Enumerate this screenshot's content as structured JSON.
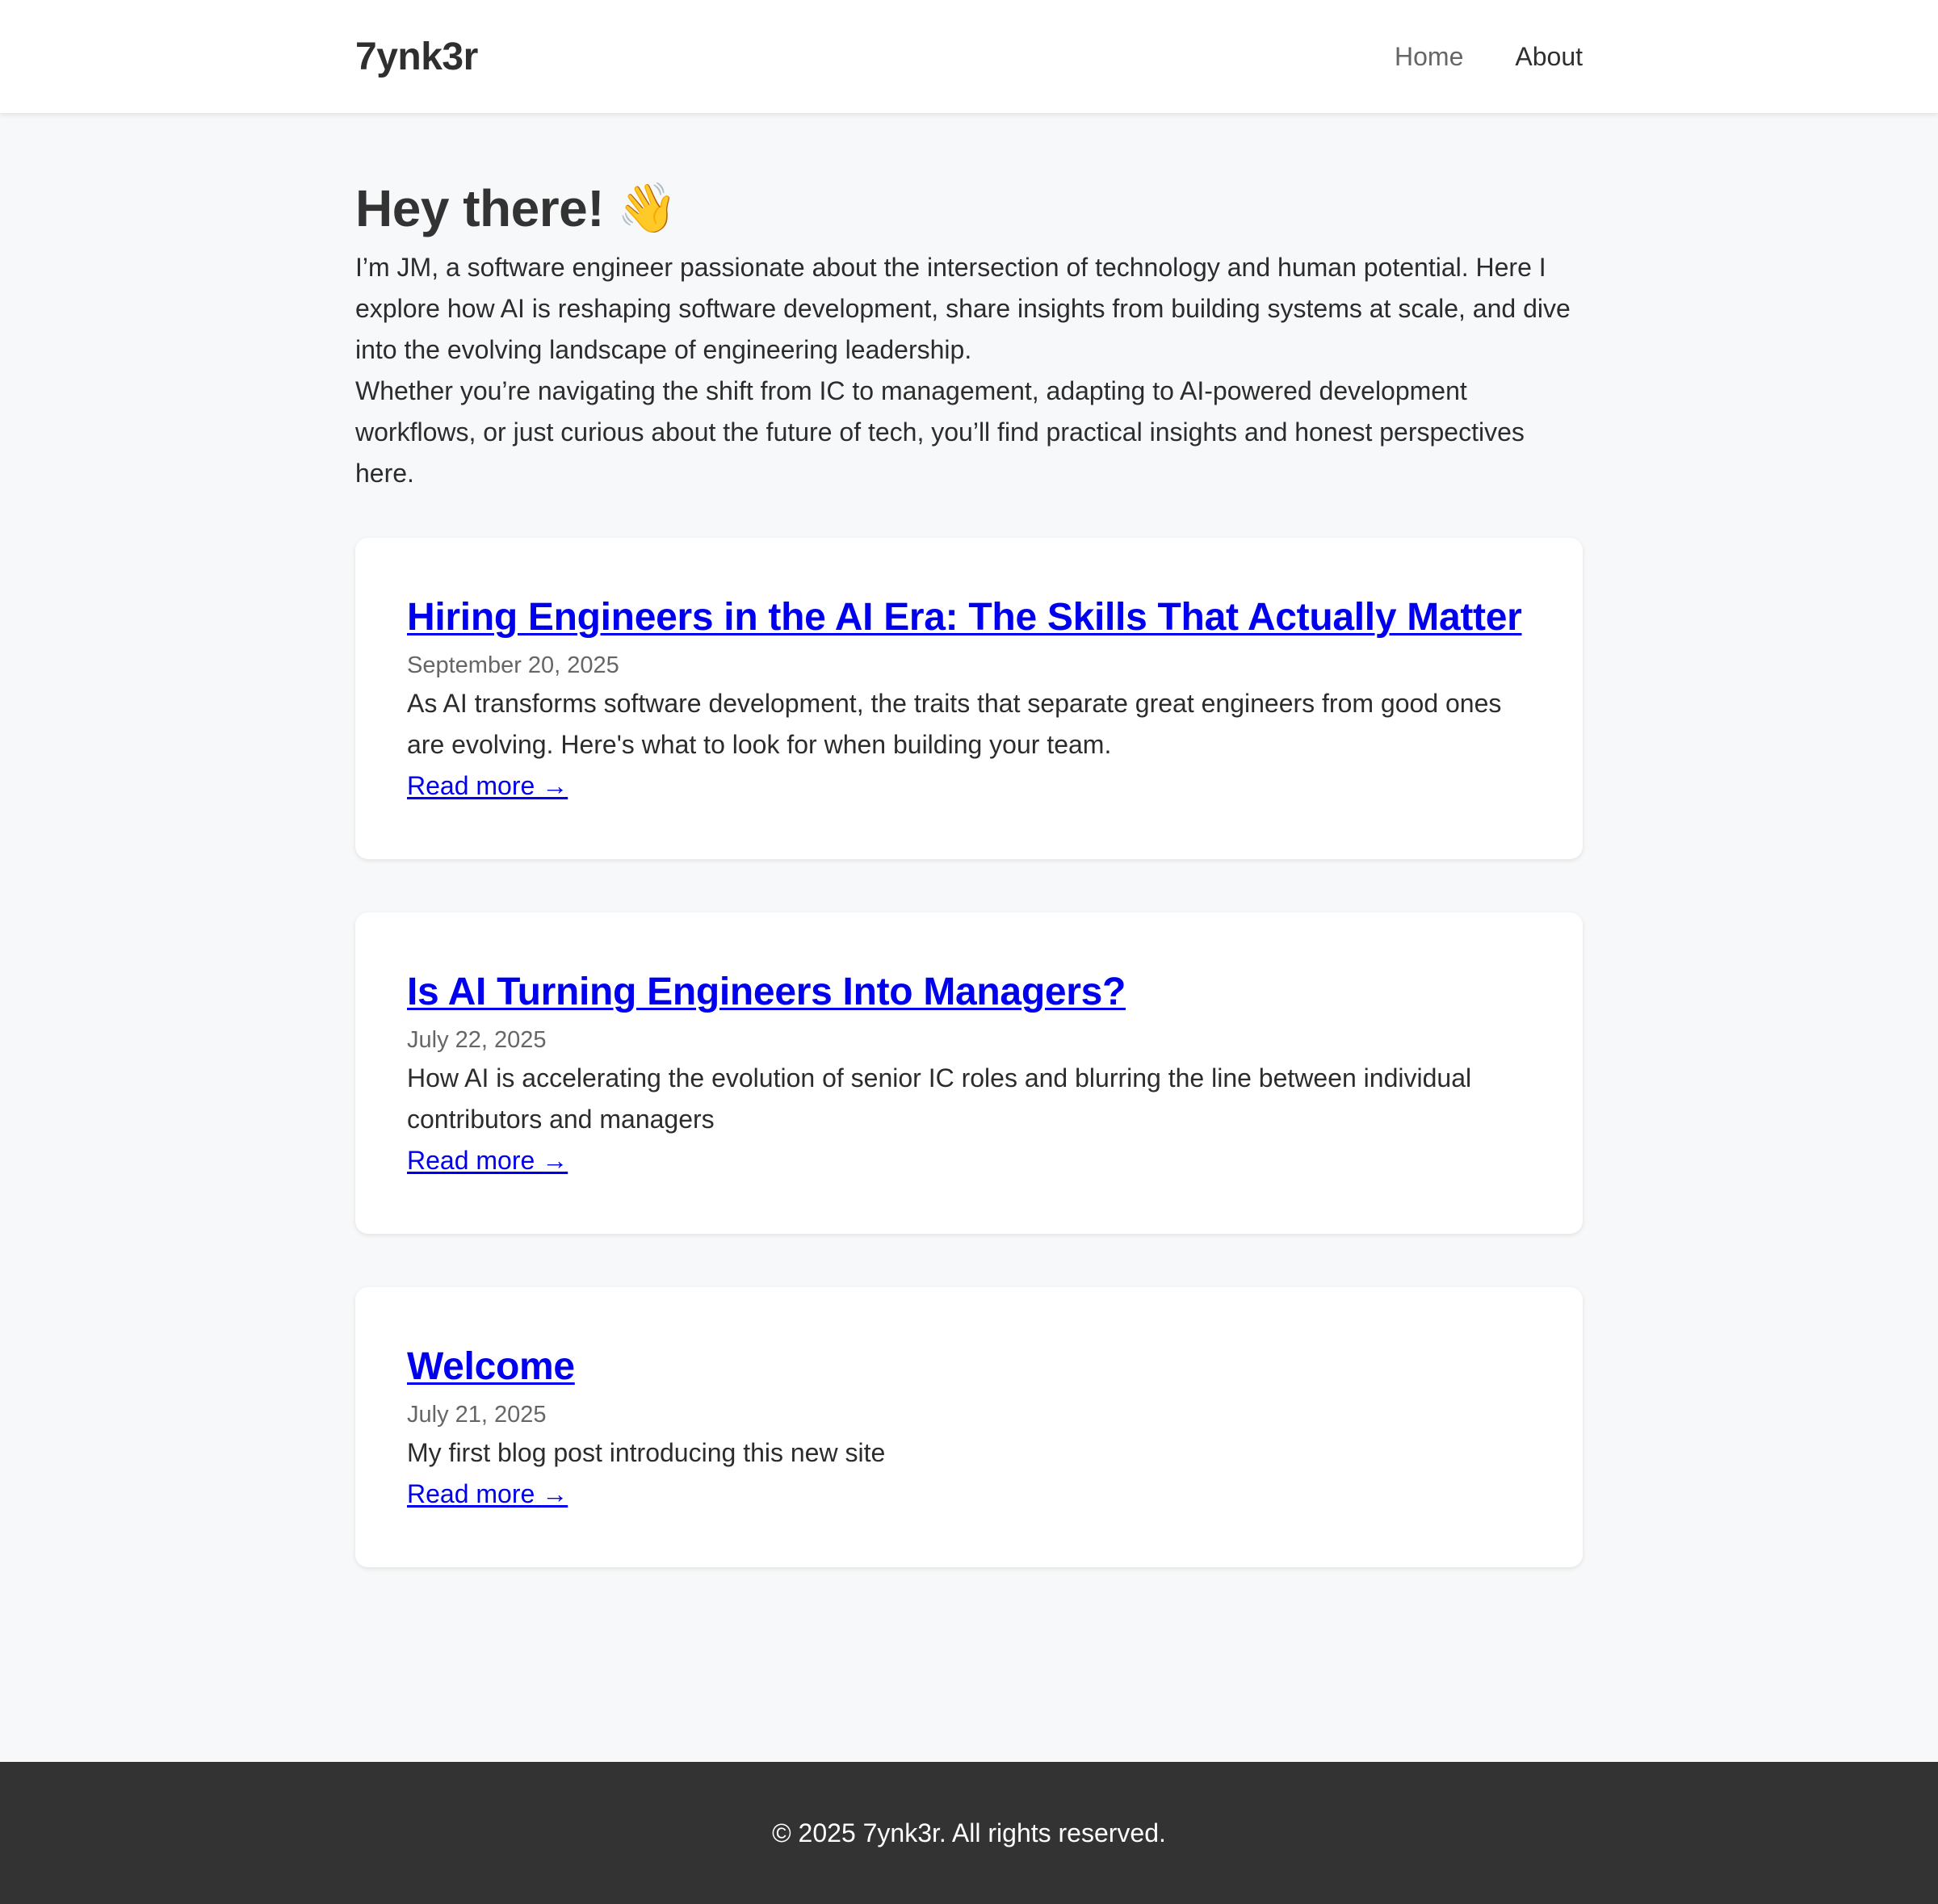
{
  "header": {
    "logo": "7ynk3r",
    "nav": [
      {
        "label": "Home"
      },
      {
        "label": "About"
      }
    ]
  },
  "hero": {
    "title": "Hey there!",
    "icon": "waving-hand-icon",
    "icon_glyph": "👋",
    "paragraphs": [
      "I’m JM, a software engineer passionate about the intersection of technology and human potential. Here I explore how AI is reshaping software development, share insights from building systems at scale, and dive into the evolving landscape of engineering leadership.",
      "Whether you’re navigating the shift from IC to management, adapting to AI-powered development workflows, or just curious about the future of tech, you’ll find practical insights and honest perspectives here."
    ]
  },
  "posts": [
    {
      "title": "Hiring Engineers in the AI Era: The Skills That Actually Matter",
      "date": "September 20, 2025",
      "excerpt": "As AI transforms software development, the traits that separate great engineers from good ones are evolving. Here's what to look for when building your team.",
      "read_more": "Read more →"
    },
    {
      "title": "Is AI Turning Engineers Into Managers?",
      "date": "July 22, 2025",
      "excerpt": "How AI is accelerating the evolution of senior IC roles and blurring the line between individual contributors and managers",
      "read_more": "Read more →"
    },
    {
      "title": "Welcome",
      "date": "July 21, 2025",
      "excerpt": "My first blog post introducing this new site",
      "read_more": "Read more →"
    }
  ],
  "footer": {
    "text": "© 2025 7ynk3r. All rights reserved."
  },
  "colors": {
    "link": "#0000ee",
    "page_background": "#f7f8f9",
    "footer_background": "#333333"
  }
}
